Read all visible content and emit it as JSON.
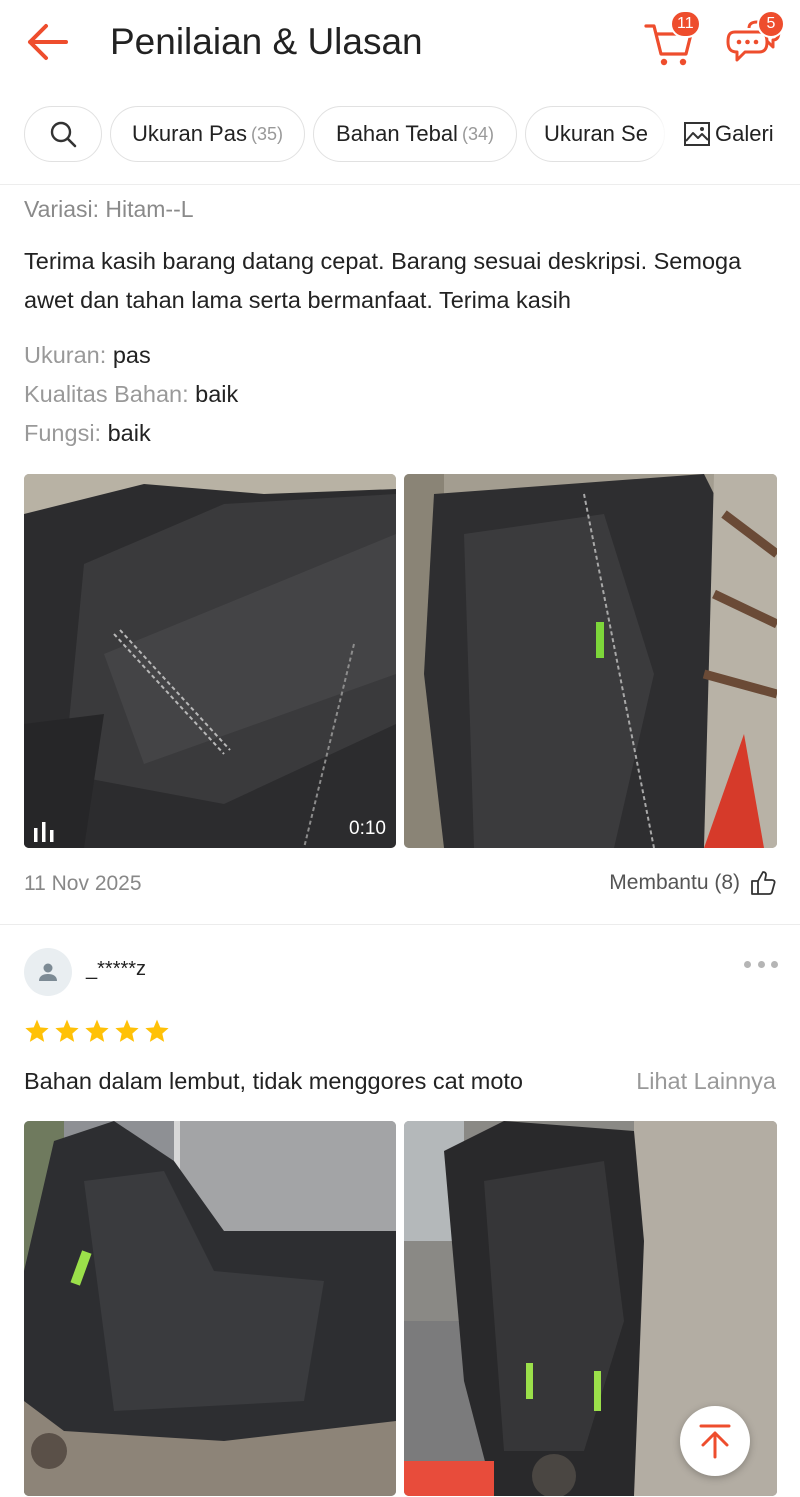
{
  "header": {
    "title": "Penilaian & Ulasan",
    "cart_count": "11",
    "chat_count": "5"
  },
  "filters": {
    "chips": [
      {
        "label": "Ukuran Pas",
        "count": "(35)"
      },
      {
        "label": "Bahan Tebal",
        "count": "(34)"
      },
      {
        "label": "Ukuran Se",
        "count": ""
      }
    ],
    "gallery_label": "Galeri"
  },
  "review1": {
    "variation": "Variasi: Hitam--L",
    "text": "Terima kasih barang datang cepat. Barang sesuai deskripsi. Semoga awet dan tahan lama serta bermanfaat. Terima kasih",
    "attributes": [
      {
        "label": "Ukuran: ",
        "value": "pas"
      },
      {
        "label": "Kualitas Bahan: ",
        "value": "baik"
      },
      {
        "label": "Fungsi: ",
        "value": "baik"
      }
    ],
    "video_duration": "0:10",
    "date": "11 Nov 2025",
    "helpful": "Membantu (8)"
  },
  "review2": {
    "username": "_*****z",
    "rating": 5,
    "text": "Bahan dalam lembut, tidak menggores cat moto",
    "see_more": "Lihat Lainnya"
  },
  "colors": {
    "accent": "#ee4d2d",
    "star": "#ffc107",
    "muted": "#999999"
  },
  "icons": [
    "back-arrow-icon",
    "cart-icon",
    "chat-icon",
    "search-icon",
    "gallery-icon",
    "video-bars-icon",
    "thumb-up-icon",
    "user-icon",
    "more-dots-icon",
    "star-icon",
    "arrow-up-icon"
  ]
}
